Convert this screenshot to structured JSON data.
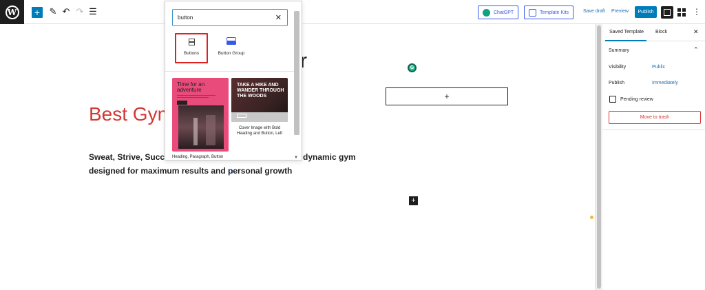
{
  "toolbar": {
    "logo_letter": "W",
    "add_symbol": "+",
    "edit_symbol": "✎",
    "undo_symbol": "↶",
    "redo_symbol": "↷",
    "list_symbol": "☰",
    "chatgpt_label": "ChatGPT",
    "template_kits_label": "Template Kits",
    "save_draft_label": "Save draft",
    "preview_label": "Preview",
    "publish_label": "Publish",
    "more_symbol": "⋮"
  },
  "inserter": {
    "search_value": "button",
    "clear_symbol": "✕",
    "blocks": [
      {
        "label": "Buttons",
        "icon": "buttons-icon"
      },
      {
        "label": "Button Group",
        "icon": "button-group-icon"
      }
    ],
    "patterns": [
      {
        "title": "Time for an adventure",
        "caption": "Heading, Paragraph, Button"
      },
      {
        "title": "TAKE A HIKE AND WANDER THROUGH THE WOODS",
        "caption": "Cover Image with Bold Heading and Button, Left"
      }
    ]
  },
  "canvas": {
    "heading_red": "Best Gym",
    "heading_black": "r",
    "para_line1a": "Sweat, Strive, Succeed",
    "para_line1b": "dynamic gym",
    "para_line2": "designed for maximum results and personal growth",
    "appender_symbol": "+",
    "dark_plus_symbol": "+",
    "grammarly_letter": "G",
    "cursor_symbol": "+"
  },
  "panel": {
    "tab_template": "Saved Template",
    "tab_block": "Block",
    "close_symbol": "✕",
    "summary_label": "Summary",
    "summary_caret": "⌃",
    "visibility_label": "Visibility",
    "visibility_value": "Public",
    "publish_label": "Publish",
    "publish_value": "Immediately",
    "pending_label": "Pending review",
    "trash_label": "Move to trash"
  },
  "colors": {
    "accent": "#007cba",
    "heading_red": "#d03a35",
    "trash_red": "#d63638"
  }
}
